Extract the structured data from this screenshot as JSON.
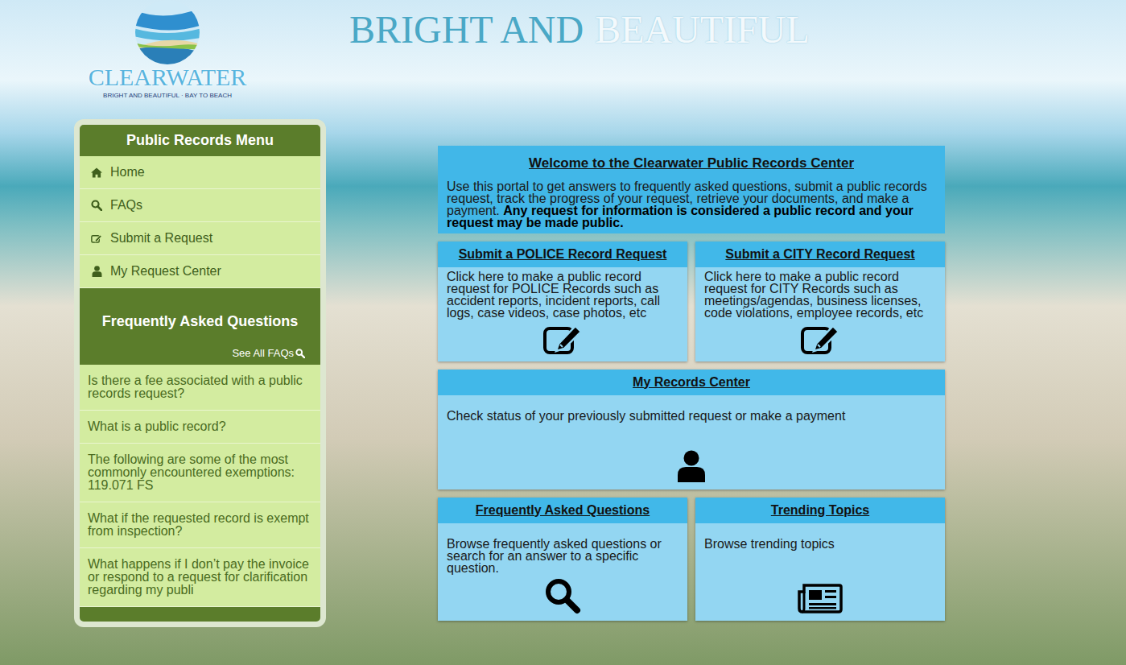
{
  "header": {
    "logo_name": "CLEARWATER",
    "logo_tagline": "BRIGHT AND BEAUTIFUL · BAY TO BEACH",
    "banner_title": "BRIGHT AND",
    "banner_title_accent": "BEAUTIFUL"
  },
  "sidebar": {
    "title": "Public Records Menu",
    "items": [
      {
        "label": "Home"
      },
      {
        "label": "FAQs"
      },
      {
        "label": "Submit a Request"
      },
      {
        "label": "My Request Center"
      }
    ]
  },
  "faq": {
    "title": "Frequently Asked Questions",
    "see_all": "See All FAQs",
    "items": [
      "Is there a fee associated with a public records request?",
      "What is a public record?",
      "The following are some of the most commonly encountered exemptions: 119.071 FS",
      "What if the requested record is exempt from inspection?",
      "What happens if I don’t pay the invoice or respond to a request for clarification regarding my publi"
    ]
  },
  "welcome": {
    "title": "Welcome to the Clearwater Public Records Center",
    "text": "Use this portal to get answers to frequently asked questions, submit a public records request, track the progress of your request, retrieve your documents, and make a payment.",
    "notice": "Any request for information is considered a public record and your request may be made public."
  },
  "card_rows": [
    [
      {
        "title": "Submit a POLICE Record Request",
        "text": "Click here to make a public record request for POLICE Records such as accident reports, incident reports, call logs, case videos, case photos, etc"
      },
      {
        "title": "Submit a CITY Record Request",
        "text": "Click here to make a public record request for CITY Records such as meetings/agendas, business licenses, code violations, employee records, etc"
      }
    ],
    [
      {
        "title": "My Records Center",
        "text": "Check status of your previously submitted request or make a payment"
      }
    ],
    [
      {
        "title": "Frequently Asked Questions",
        "text": "Browse frequently asked questions or search for an answer to a specific question."
      },
      {
        "title": "Trending Topics",
        "text": "Browse trending topics"
      }
    ]
  ]
}
